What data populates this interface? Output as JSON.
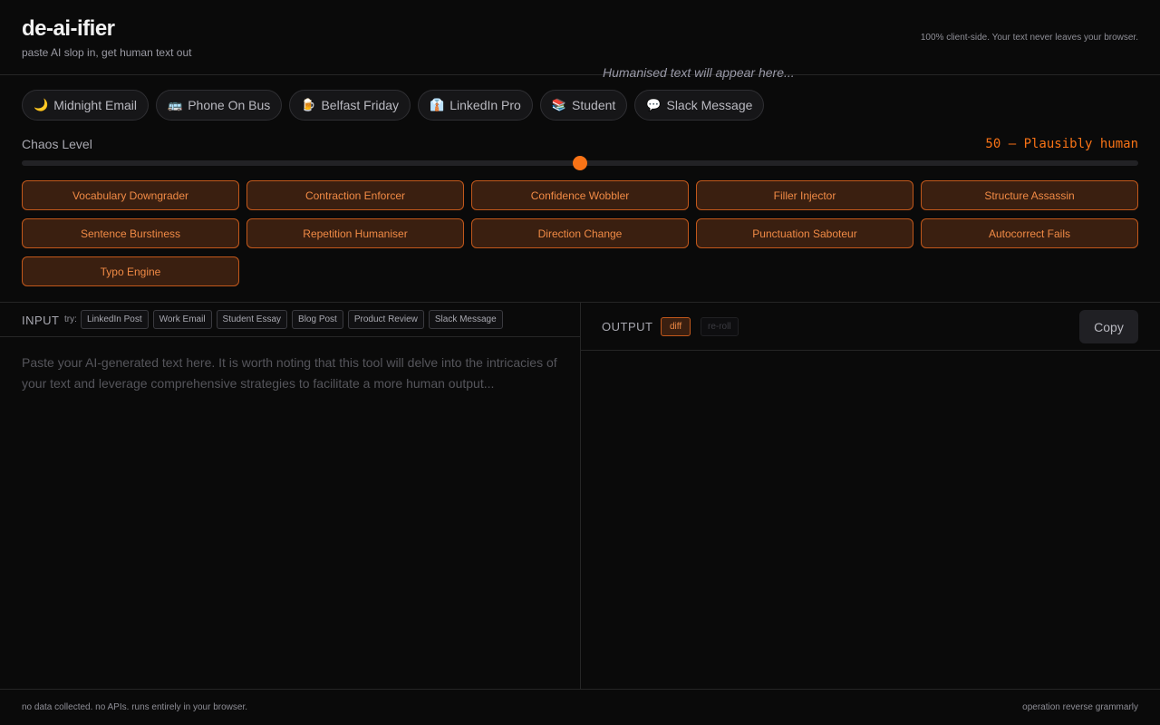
{
  "header": {
    "title": "de-ai-ifier",
    "subtitle": "paste AI slop in, get human text out",
    "privacy_note": "100% client-side. Your text never leaves your browser."
  },
  "presets": [
    {
      "icon": "🌙",
      "icon_name": "moon-icon",
      "label": "Midnight Email"
    },
    {
      "icon": "🚌",
      "icon_name": "bus-icon",
      "label": "Phone On Bus"
    },
    {
      "icon": "🍺",
      "icon_name": "beer-icon",
      "label": "Belfast Friday"
    },
    {
      "icon": "👔",
      "icon_name": "necktie-icon",
      "label": "LinkedIn Pro"
    },
    {
      "icon": "📚",
      "icon_name": "books-icon",
      "label": "Student"
    },
    {
      "icon": "💬",
      "icon_name": "speech-bubble-icon",
      "label": "Slack Message"
    }
  ],
  "chaos": {
    "label": "Chaos Level",
    "value_text": "50 — Plausibly human",
    "value": 50,
    "min": 0,
    "max": 100
  },
  "modules": [
    "Vocabulary Downgrader",
    "Contraction Enforcer",
    "Confidence Wobbler",
    "Filler Injector",
    "Structure Assassin",
    "Sentence Burstiness",
    "Repetition Humaniser",
    "Direction Change",
    "Punctuation Saboteur",
    "Autocorrect Fails",
    "Typo Engine"
  ],
  "input": {
    "label": "INPUT",
    "try_label": "try:",
    "samples": [
      "LinkedIn Post",
      "Work Email",
      "Student Essay",
      "Blog Post",
      "Product Review",
      "Slack Message"
    ],
    "value": "",
    "placeholder": "Paste your AI-generated text here. It is worth noting that this tool will delve into the intricacies of your text and leverage comprehensive strategies to facilitate a more human output..."
  },
  "output": {
    "label": "OUTPUT",
    "diff_label": "diff",
    "reroll_label": "re-roll",
    "copy_label": "Copy",
    "placeholder": "Humanised text will appear here..."
  },
  "footer": {
    "left": "no data collected. no APIs. runs entirely in your browser.",
    "right": "operation reverse grammarly"
  },
  "colors": {
    "accent": "#f97316",
    "background": "#0a0a0a",
    "module_bg": "#3a1f10",
    "module_border": "#c2581b"
  }
}
